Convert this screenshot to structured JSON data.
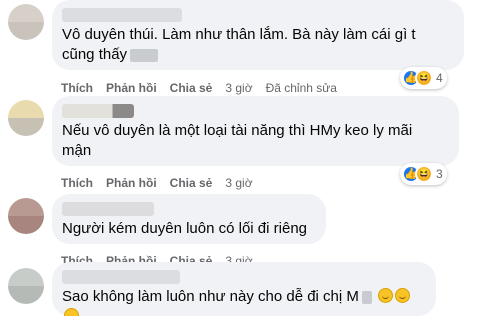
{
  "comments": [
    {
      "text_line1": "Vô duyên thúi. Làm như thân lắm. Bà này làm cái gì t",
      "text_line2": "cũng thấy",
      "actions": {
        "like": "Thích",
        "reply": "Phản hồi",
        "share": "Chia sẻ",
        "time": "3 giờ",
        "edited": "Đã chỉnh sửa"
      },
      "reaction_count": "4"
    },
    {
      "text_line1": "Nếu vô duyên là một loại tài năng thì HMy keo ly mãi",
      "text_line2": "mận",
      "actions": {
        "like": "Thích",
        "reply": "Phản hồi",
        "share": "Chia sẻ",
        "time": "3 giờ"
      },
      "reaction_count": "3"
    },
    {
      "text_line1": "Người kém duyên luôn có lối đi riêng",
      "actions": {
        "like": "Thích",
        "reply": "Phản hồi",
        "share": "Chia sẻ",
        "time": "3 giờ"
      }
    },
    {
      "text_line1": "Sao không làm luôn như này cho dễ đi chị M"
    }
  ],
  "icons": {
    "like": "like-icon",
    "haha": "haha-icon",
    "emoji": "smile-emoji-icon"
  },
  "colors": {
    "bubble": "#f0f2f5",
    "meta": "#65676b",
    "like_blue": "#1877f2",
    "haha_yellow": "#f7b125"
  }
}
